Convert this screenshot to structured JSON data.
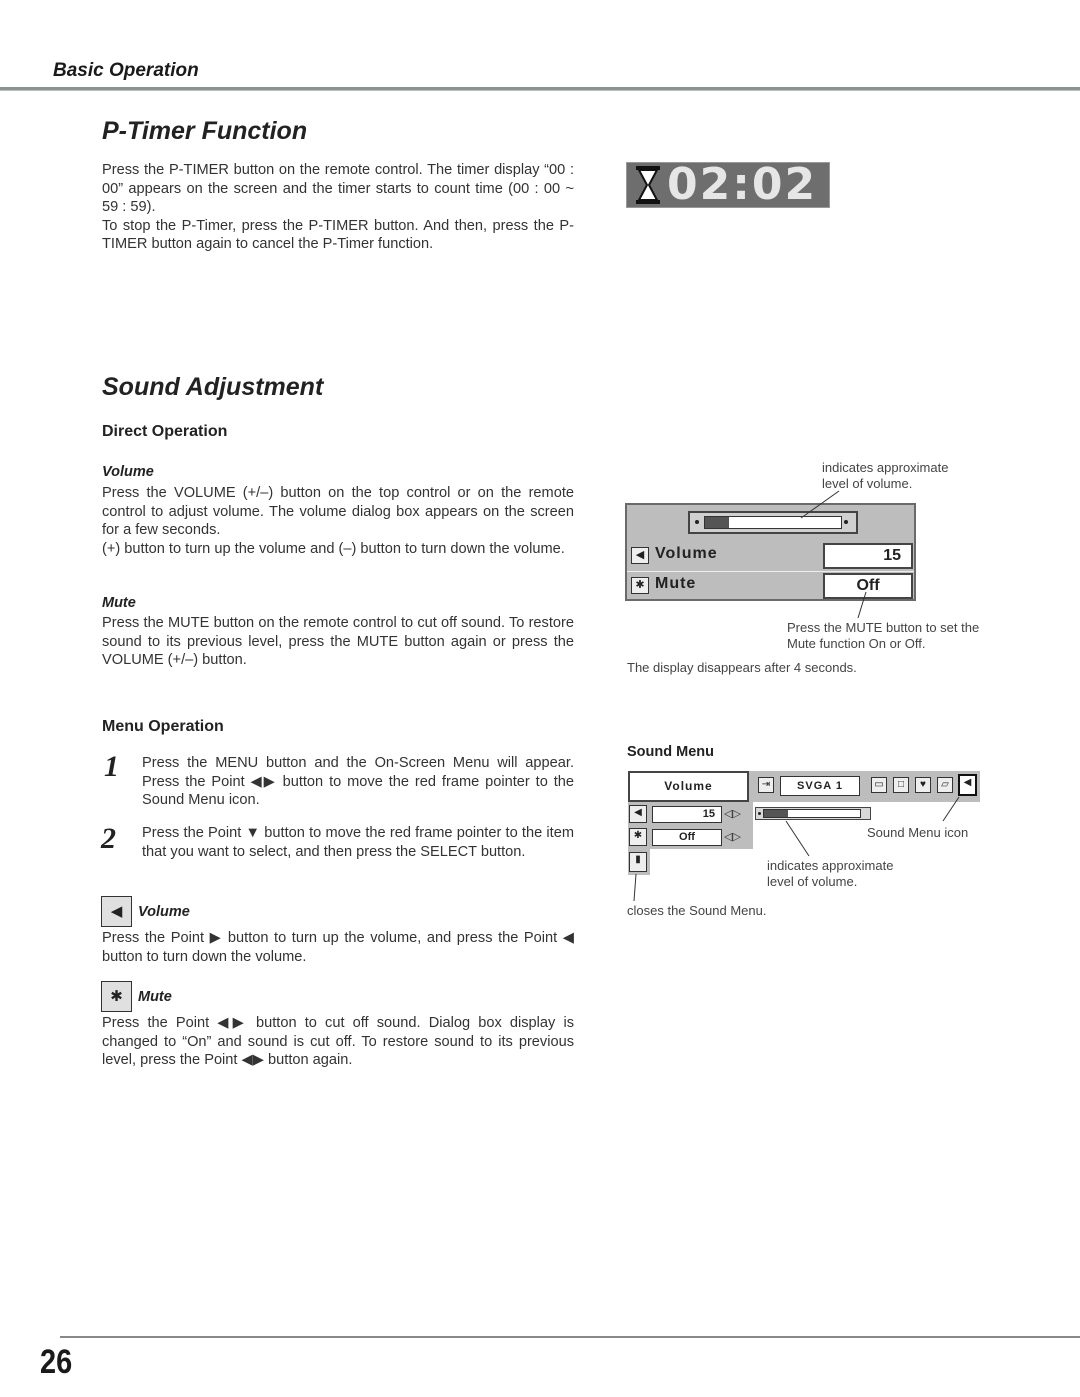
{
  "header": {
    "section": "Basic Operation"
  },
  "ptimer": {
    "title": "P-Timer Function",
    "paragraphs": [
      "Press the P-TIMER button on the remote control.  The timer display “00 : 00” appears on the screen and the timer starts to count time (00 : 00 ~ 59 : 59).",
      "To stop the P-Timer, press the P-TIMER button.  And then, press the P-TIMER button again to cancel the  P-Timer function."
    ],
    "display": {
      "icon": "hourglass-icon",
      "time": "02:02"
    }
  },
  "sound": {
    "title": "Sound Adjustment",
    "direct": {
      "heading": "Direct Operation",
      "volume_heading": "Volume",
      "volume_paragraphs": [
        "Press the VOLUME (+/–) button on the top control or on the remote control to adjust volume.  The volume dialog box appears on the screen for a few seconds.",
        "(+) button to turn up the volume and (–) button to turn down the volume."
      ],
      "mute_heading": "Mute",
      "mute_paragraph": "Press the MUTE button on the remote control to cut off sound.  To restore sound to its previous level, press the MUTE button again or press the VOLUME (+/–) button."
    },
    "dialog": {
      "caption_level": "indicates approximate level of volume.",
      "volume_label": "Volume",
      "volume_value": "15",
      "volume_level_fraction": 0.18,
      "mute_label": "Mute",
      "mute_value": "Off",
      "caption_mute": "Press the MUTE button to set the Mute function On or Off.",
      "caption_disappear": "The display disappears after 4 seconds.",
      "icons": {
        "volume": "speaker-icon",
        "mute": "mute-icon"
      }
    },
    "menu": {
      "heading": "Menu Operation",
      "steps": [
        {
          "num": "1",
          "text": "Press the MENU button and the On-Screen Menu will appear.  Press the Point ◀▶ button to move the red frame pointer to the Sound Menu icon."
        },
        {
          "num": "2",
          "text": "Press the Point ▼ button to move the red frame pointer to the item that you want to select, and then press the SELECT button."
        }
      ],
      "volume_heading": "Volume",
      "volume_paragraph": "Press the Point  ▶ button to turn up the volume, and press the Point ◀ button to turn down the volume.",
      "mute_heading": "Mute",
      "mute_paragraph": "Press the Point ◀▶ button to cut off sound.  Dialog box display is changed to “On” and sound is cut off.  To restore sound to its previous level, press the Point ◀▶ button again."
    },
    "sound_menu": {
      "heading": "Sound Menu",
      "selected_label": "Volume",
      "source_label": "SVGA 1",
      "volume_value": "15",
      "volume_level_fraction": 0.25,
      "mute_value": "Off",
      "caption_icon": "Sound Menu icon",
      "caption_level": "indicates approximate level of volume.",
      "caption_close": "closes the Sound Menu."
    }
  },
  "footer": {
    "page_number": "26"
  }
}
